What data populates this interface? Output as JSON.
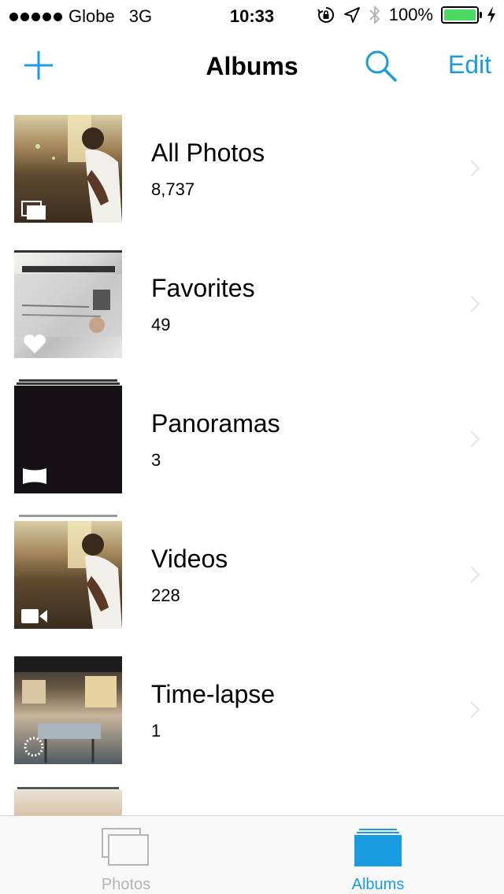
{
  "status_bar": {
    "carrier": "Globe",
    "network": "3G",
    "time": "10:33",
    "battery": "100%",
    "battery_level": 1.0
  },
  "nav": {
    "title": "Albums",
    "edit_label": "Edit",
    "add_icon": "plus-icon",
    "search_icon": "search-icon"
  },
  "albums": [
    {
      "title": "All Photos",
      "count": "8,737",
      "badge_icon": "photo-stack-icon"
    },
    {
      "title": "Favorites",
      "count": "49",
      "badge_icon": "heart-icon"
    },
    {
      "title": "Panoramas",
      "count": "3",
      "badge_icon": "panorama-icon"
    },
    {
      "title": "Videos",
      "count": "228",
      "badge_icon": "video-camera-icon"
    },
    {
      "title": "Time-lapse",
      "count": "1",
      "badge_icon": "time-lapse-icon"
    }
  ],
  "tabs": [
    {
      "label": "Photos",
      "selected": false
    },
    {
      "label": "Albums",
      "selected": true
    }
  ],
  "colors": {
    "accent": "#1a9ce0",
    "tab_selected": "#1a9ce0",
    "tab_unselected": "#b4b4b4",
    "battery": "#4cd964"
  }
}
